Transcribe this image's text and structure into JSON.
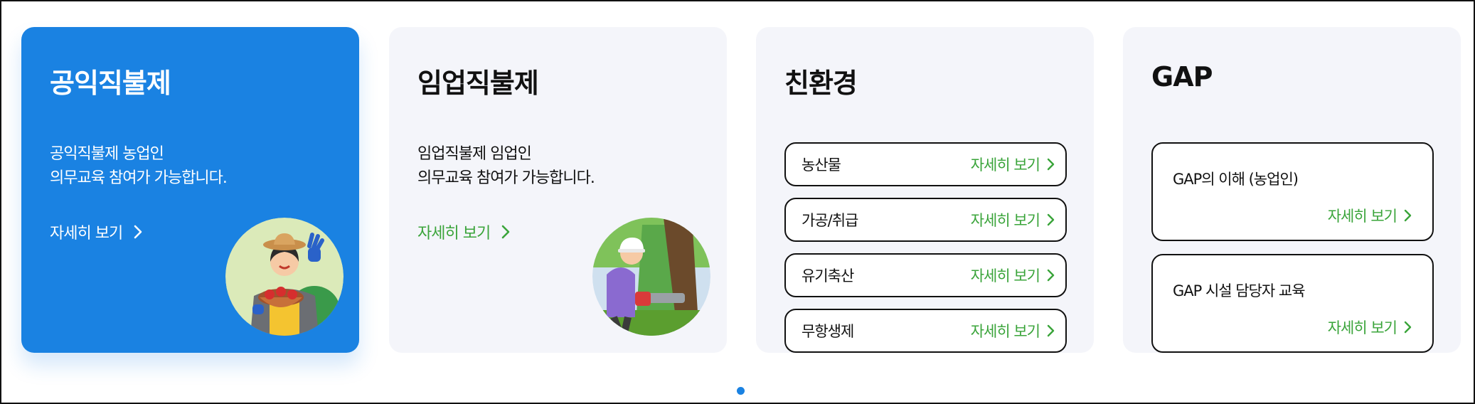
{
  "cards": [
    {
      "title": "공익직불제",
      "desc_line1": "공익직불제 농업인",
      "desc_line2": "의무교육 참여가 가능합니다.",
      "more_label": "자세히 보기"
    },
    {
      "title": "임업직불제",
      "desc_line1": "임업직불제 임업인",
      "desc_line2": "의무교육 참여가 가능합니다.",
      "more_label": "자세히 보기"
    },
    {
      "title": "친환경",
      "items": [
        {
          "label": "농산물",
          "more": "자세히 보기"
        },
        {
          "label": "가공/취급",
          "more": "자세히 보기"
        },
        {
          "label": "유기축산",
          "more": "자세히 보기"
        },
        {
          "label": "무항생제",
          "more": "자세히 보기"
        }
      ]
    },
    {
      "title": "GAP",
      "items": [
        {
          "label": "GAP의 이해 (농업인)",
          "more": "자세히 보기"
        },
        {
          "label": "GAP 시설 담당자 교육",
          "more": "자세히 보기"
        }
      ]
    }
  ],
  "pagination": {
    "current": 1,
    "total": 1
  },
  "colors": {
    "accent": "#1a82e2",
    "green": "#3aa43a",
    "card_bg": "#f4f5fa"
  },
  "icons": {
    "card1_illustration": "farmer-with-fruit-basket-illustration",
    "card2_illustration": "forester-with-chainsaw-illustration",
    "chevron": "chevron-right-icon"
  }
}
